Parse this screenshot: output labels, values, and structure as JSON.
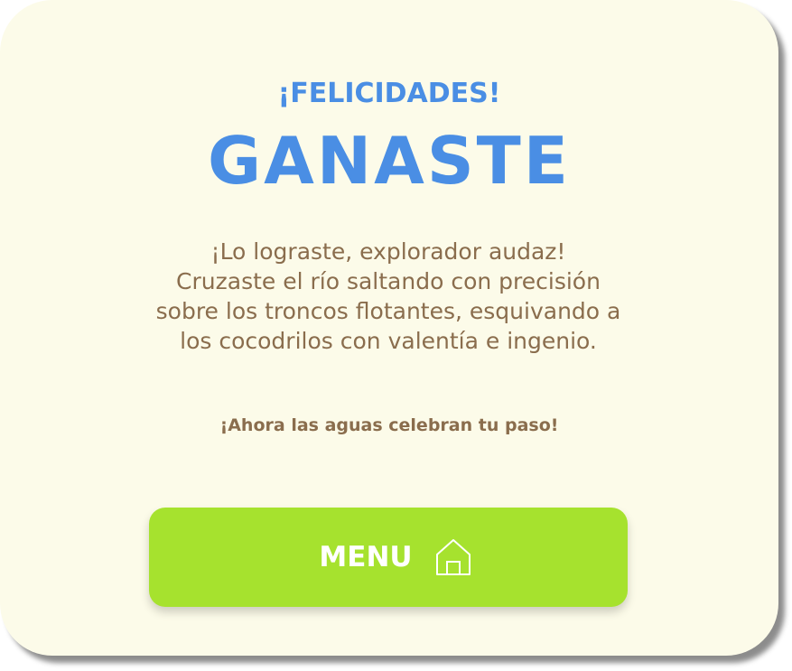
{
  "dialog": {
    "subtitle": "¡FELICIDADES!",
    "title": "GANASTE",
    "message": "¡Lo lograste, explorador audaz!\nCruzaste el río saltando con precisión\nsobre los troncos flotantes, esquivando a\nlos cocodrilos con valentía e ingenio.",
    "tagline": "¡Ahora las aguas celebran tu paso!"
  },
  "menu_button": {
    "label": "MENU",
    "icon": "home-icon"
  },
  "colors": {
    "card_background": "#fcfbe9",
    "accent_blue": "#4a8ee4",
    "text_brown": "#8a6d4d",
    "button_green": "#a6e22e"
  }
}
